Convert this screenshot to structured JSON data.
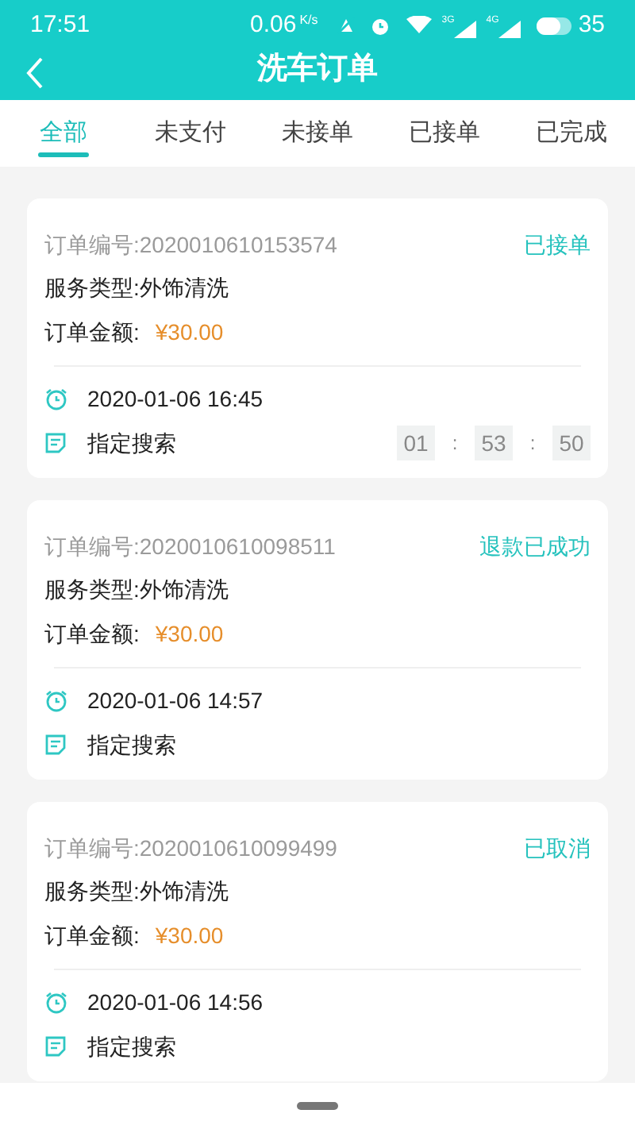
{
  "status_bar": {
    "time": "17:51",
    "speed": "0.06",
    "speed_unit": "K/s",
    "net_3g": "3G",
    "net_4g": "4G",
    "battery": "35"
  },
  "header": {
    "title": "洗车订单"
  },
  "tabs": [
    {
      "label": "全部",
      "selected": true
    },
    {
      "label": "未支付",
      "selected": false
    },
    {
      "label": "未接单",
      "selected": false
    },
    {
      "label": "已接单",
      "selected": false
    },
    {
      "label": "已完成",
      "selected": false
    }
  ],
  "orders": [
    {
      "order_no": "订单编号:2020010610153574",
      "status": "已接单",
      "service": "服务类型:外饰清洗",
      "amount_label": "订单金额:",
      "amount": "¥30.00",
      "time": "2020-01-06 16:45",
      "note": "指定搜索",
      "countdown": [
        "01",
        ":",
        "53",
        ":",
        "50"
      ]
    },
    {
      "order_no": "订单编号:2020010610098511",
      "status": "退款已成功",
      "service": "服务类型:外饰清洗",
      "amount_label": "订单金额:",
      "amount": "¥30.00",
      "time": "2020-01-06 14:57",
      "note": "指定搜索"
    },
    {
      "order_no": "订单编号:2020010610099499",
      "status": "已取消",
      "service": "服务类型:外饰清洗",
      "amount_label": "订单金额:",
      "amount": "¥30.00",
      "time": "2020-01-06 14:56",
      "note": "指定搜索"
    }
  ]
}
